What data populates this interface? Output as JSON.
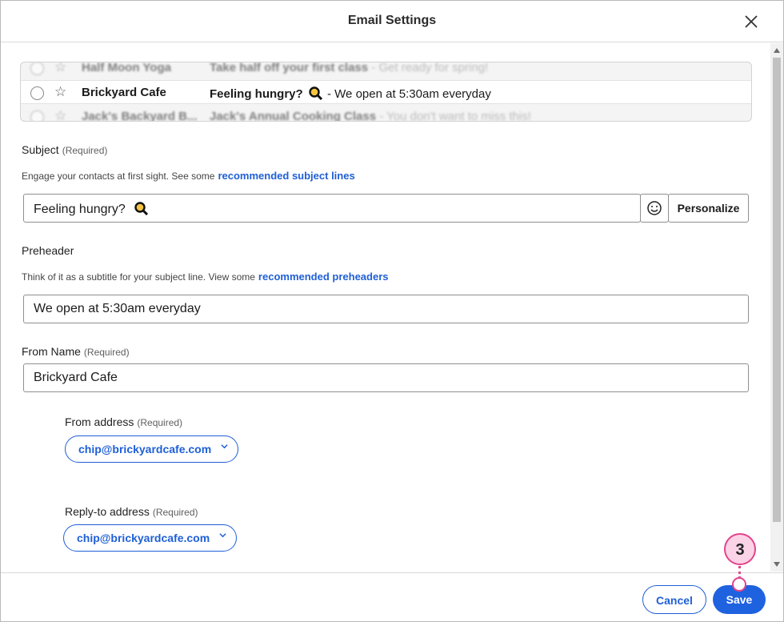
{
  "dialog": {
    "title": "Email Settings"
  },
  "preview": {
    "rows": [
      {
        "from": "Half Moon Yoga",
        "subject": "Take half off your first class",
        "preheader": " - Get ready for spring!"
      },
      {
        "from": "Brickyard Cafe",
        "subject": "Feeling hungry?",
        "preheader": " - We open at 5:30am everyday"
      },
      {
        "from": "Jack's Backyard B...",
        "subject": "Jack's Annual Cooking Class",
        "preheader": " - You don't want to miss this!"
      }
    ]
  },
  "subject": {
    "label": "Subject",
    "required": "(Required)",
    "hint": "Engage your contacts at first sight. See some",
    "hint_link": "recommended subject lines",
    "value": "Feeling hungry?",
    "personalize": "Personalize"
  },
  "preheader": {
    "label": "Preheader",
    "hint": "Think of it as a subtitle for your subject line. View some",
    "hint_link": "recommended preheaders",
    "value": "We open at 5:30am everyday"
  },
  "from_name": {
    "label": "From Name",
    "required": "(Required)",
    "value": "Brickyard Cafe"
  },
  "from_address": {
    "label": "From address",
    "required": "(Required)",
    "value": "chip@brickyardcafe.com"
  },
  "reply_to": {
    "label": "Reply-to address",
    "required": "(Required)",
    "value": "chip@brickyardcafe.com"
  },
  "footer": {
    "cancel": "Cancel",
    "save": "Save"
  },
  "callout": {
    "number": "3"
  },
  "colors": {
    "accent": "#1f62e0",
    "link": "#1f5fd6",
    "callout_border": "#e2448c",
    "callout_fill": "#fbd3e6"
  }
}
